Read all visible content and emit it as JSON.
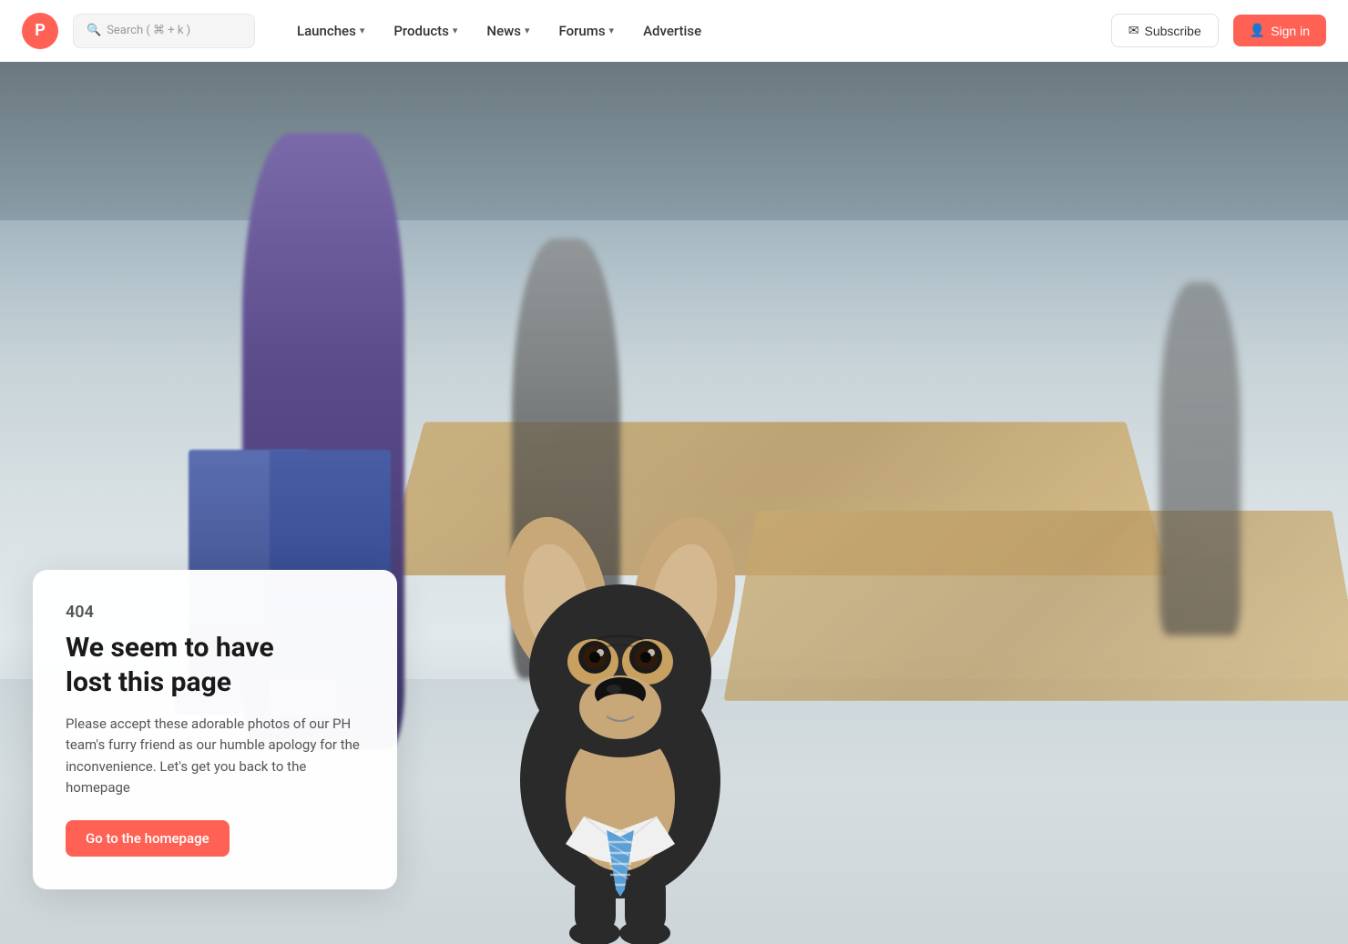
{
  "navbar": {
    "logo_letter": "P",
    "search_placeholder": "Search ( ⌘ + k )",
    "nav_items": [
      {
        "label": "Launches",
        "has_dropdown": true
      },
      {
        "label": "Products",
        "has_dropdown": true
      },
      {
        "label": "News",
        "has_dropdown": true
      },
      {
        "label": "Forums",
        "has_dropdown": true
      },
      {
        "label": "Advertise",
        "has_dropdown": false
      }
    ],
    "subscribe_label": "Subscribe",
    "signin_label": "Sign in"
  },
  "error_page": {
    "code": "404",
    "heading_line1": "We seem to have",
    "heading_line2": "lost this page",
    "description": "Please accept these adorable photos of our PH team's furry friend as our humble apology for the inconvenience. Let's get you back to the homepage",
    "cta_label": "Go to the homepage"
  },
  "colors": {
    "brand": "#ff6154",
    "text_dark": "#1a1a1a",
    "text_mid": "#555555",
    "nav_bg": "#ffffff"
  }
}
